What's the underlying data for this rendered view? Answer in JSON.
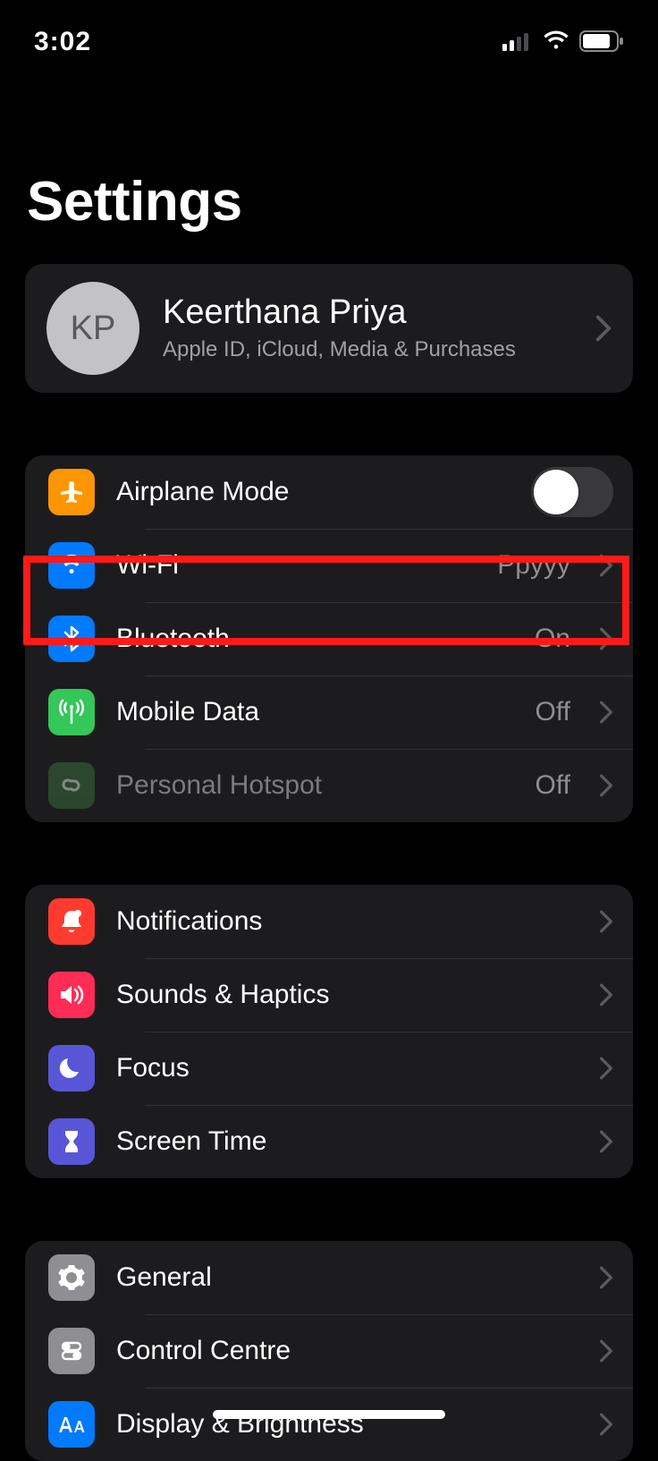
{
  "status": {
    "time": "3:02"
  },
  "title": "Settings",
  "profile": {
    "initials": "KP",
    "name": "Keerthana Priya",
    "subtitle": "Apple ID, iCloud, Media & Purchases"
  },
  "rows": {
    "airplane": {
      "label": "Airplane Mode"
    },
    "wifi": {
      "label": "Wi-Fi",
      "detail": "Ppyyy"
    },
    "bluetooth": {
      "label": "Bluetooth",
      "detail": "On"
    },
    "mobiledata": {
      "label": "Mobile Data",
      "detail": "Off"
    },
    "hotspot": {
      "label": "Personal Hotspot",
      "detail": "Off"
    },
    "notifications": {
      "label": "Notifications"
    },
    "sounds": {
      "label": "Sounds & Haptics"
    },
    "focus": {
      "label": "Focus"
    },
    "screentime": {
      "label": "Screen Time"
    },
    "general": {
      "label": "General"
    },
    "control": {
      "label": "Control Centre"
    },
    "display": {
      "label": "Display & Brightness"
    }
  }
}
